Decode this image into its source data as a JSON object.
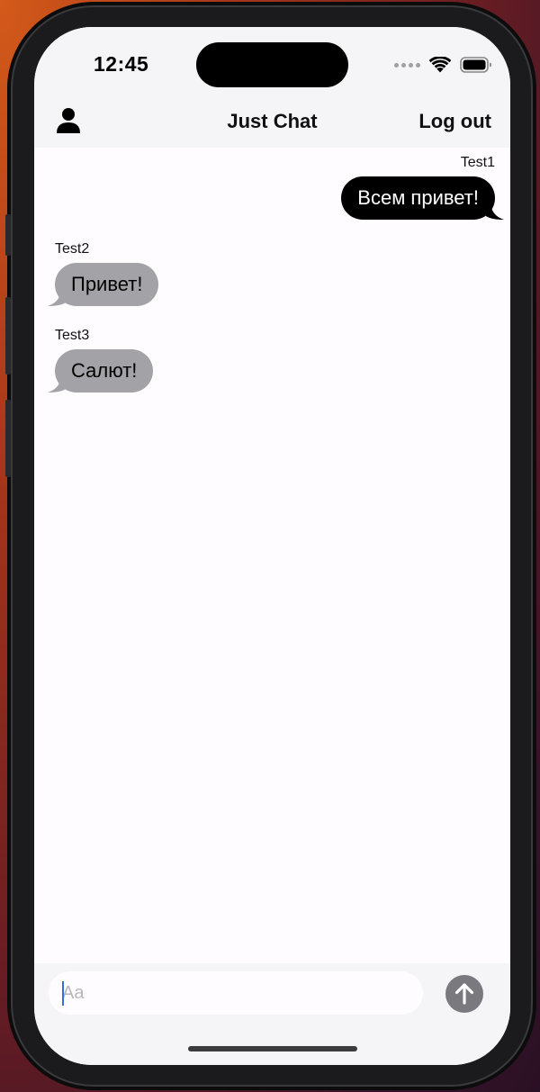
{
  "status_bar": {
    "time": "12:45"
  },
  "nav": {
    "title": "Just Chat",
    "logout_label": "Log out",
    "profile_icon": "person-icon"
  },
  "messages": [
    {
      "sender": "Test1",
      "text": "Всем привет!",
      "direction": "outgoing"
    },
    {
      "sender": "Test2",
      "text": "Привет!",
      "direction": "incoming"
    },
    {
      "sender": "Test3",
      "text": "Салют!",
      "direction": "incoming"
    }
  ],
  "composer": {
    "placeholder": "Aa",
    "value": "",
    "send_icon": "arrow-up-icon"
  },
  "colors": {
    "outgoing_bubble": "#000000",
    "incoming_bubble": "#a3a2a7",
    "bar_background": "#f5f4f6",
    "send_button": "#7a797d"
  }
}
